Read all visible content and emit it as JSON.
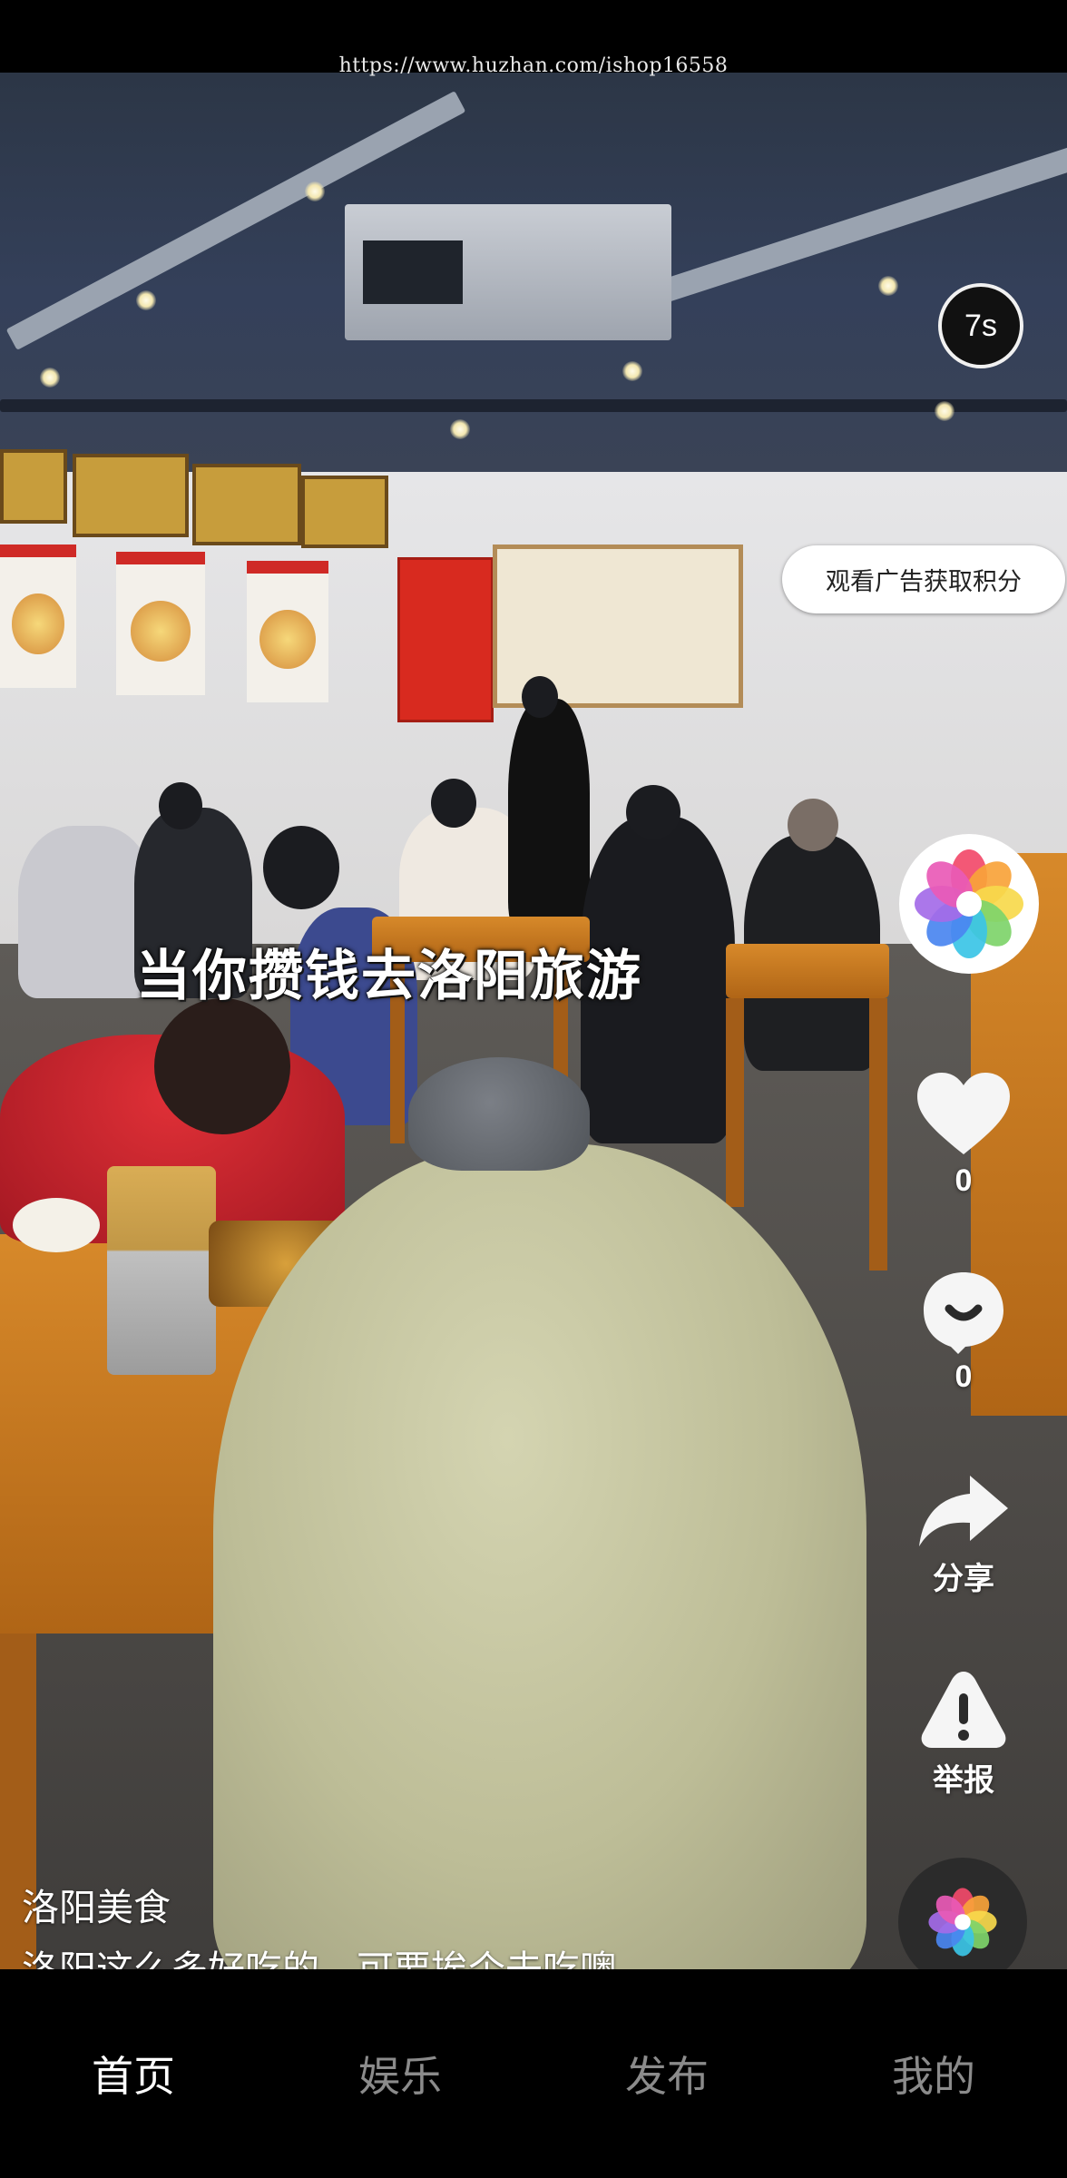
{
  "watermark": "https://www.huzhan.com/ishop16558",
  "video": {
    "caption": "当你攒钱去洛阳旅游",
    "countdown": "7s"
  },
  "ad_button": "观看广告获取积分",
  "rail": {
    "avatar_icon": "pinwheel-icon",
    "like": {
      "icon": "heart-icon",
      "count": "0"
    },
    "comment": {
      "icon": "comment-icon",
      "count": "0"
    },
    "share": {
      "icon": "share-arrow-icon",
      "label": "分享"
    },
    "report": {
      "icon": "warning-icon",
      "label": "举报"
    }
  },
  "info": {
    "author": "洛阳美食",
    "description": "洛阳这么多好吃的，可要挨个去吃噢"
  },
  "bottom_nav": [
    {
      "label": "首页",
      "active": true
    },
    {
      "label": "娱乐",
      "active": false
    },
    {
      "label": "发布",
      "active": false
    },
    {
      "label": "我的",
      "active": false
    }
  ],
  "colors": {
    "pinwheel": [
      "#f24a6a",
      "#f9a33a",
      "#f7d94c",
      "#7ed46a",
      "#3bc4e6",
      "#4a86f0",
      "#a46be8",
      "#e95ab6"
    ],
    "nav_active": "#ffffff",
    "nav_inactive": "#8b8b8b"
  }
}
